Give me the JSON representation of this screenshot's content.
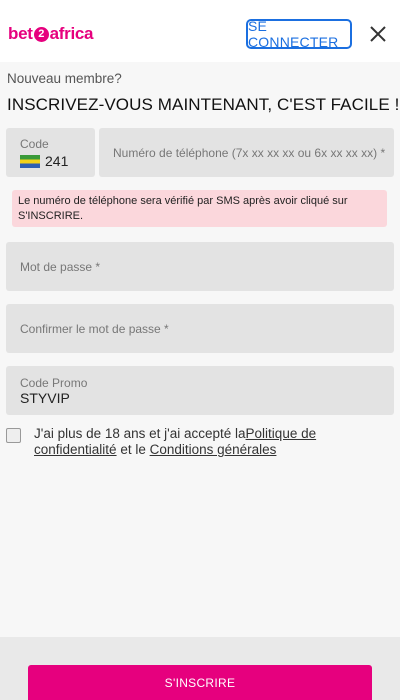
{
  "header": {
    "logo_left": "bet",
    "logo_two": "2",
    "logo_right": "africa",
    "connect_label": "SE CONNECTER"
  },
  "intro": {
    "subtitle": "Nouveau membre?",
    "title": "INSCRIVEZ-VOUS MAINTENANT, C'EST FACILE !"
  },
  "form": {
    "code_label": "Code",
    "code_value": "241",
    "phone_placeholder": "Numéro de téléphone (7x xx xx xx ou 6x xx xx xx) *",
    "sms_notice": "Le numéro de téléphone sera vérifié par SMS après avoir cliqué sur S'INSCRIRE.",
    "password_placeholder": "Mot de passe *",
    "confirm_password_placeholder": "Confirmer le mot de passe *",
    "promo_label": "Code Promo",
    "promo_value": "STYVIP",
    "terms_prefix": "J'ai plus de 18 ans et j'ai accepté la",
    "privacy_link": "Politique de confidentialité",
    "terms_middle": " et le ",
    "conditions_link": "Conditions générales"
  },
  "footer": {
    "submit_label": "S'INSCRIRE"
  },
  "colors": {
    "brand": "#e6007e",
    "link_button": "#1b6fe0",
    "notice_bg": "#fbd7dc"
  },
  "icons": {
    "close": "close-icon",
    "flag": "gabon-flag-icon"
  }
}
